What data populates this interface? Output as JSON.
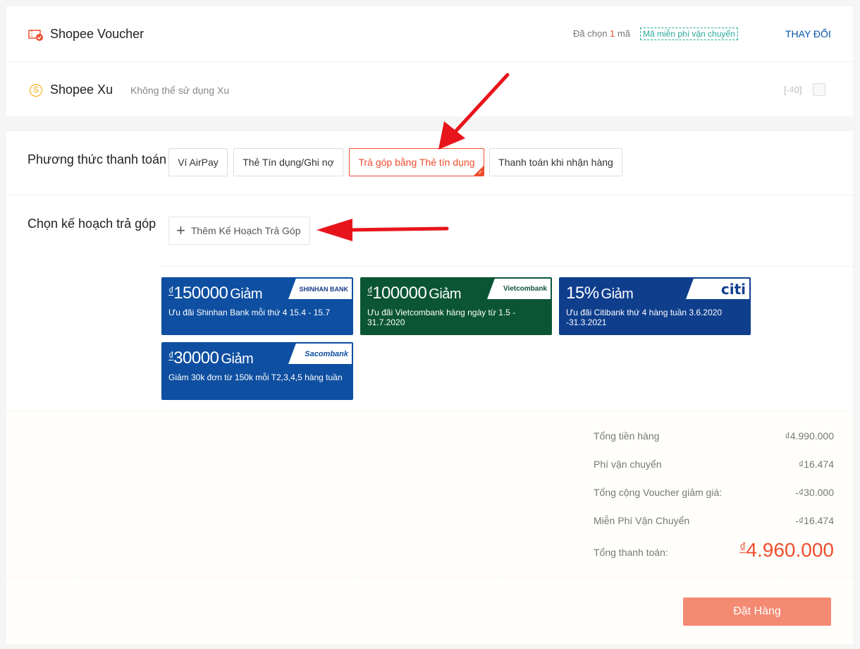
{
  "voucher": {
    "title": "Shopee Voucher",
    "selected_prefix": "Đã chọn",
    "selected_count": "1",
    "selected_suffix": "mã",
    "tag": "Mã miễn phí vận chuyển",
    "change_label": "THAY ĐỔI"
  },
  "xu": {
    "title": "Shopee Xu",
    "note": "Không thể sử dụng Xu",
    "value": "[-₫0]"
  },
  "payment": {
    "label": "Phương thức thanh toán",
    "methods": [
      {
        "label": "Ví AirPay"
      },
      {
        "label": "Thẻ Tín dụng/Ghi nợ"
      },
      {
        "label": "Trả góp bằng Thẻ tín dụng",
        "selected": true
      },
      {
        "label": "Thanh toán khi nhận hàng"
      }
    ]
  },
  "installment": {
    "label": "Chọn kế hoạch trả góp",
    "add_label": "Thêm Kế Hoạch Trả Góp"
  },
  "promos": [
    {
      "currency": "₫",
      "amount": "150000",
      "giam": "Giảm",
      "desc": "Ưu đãi Shinhan Bank mỗi thứ 4 15.4 - 15.7",
      "bank": "SHINHAN BANK",
      "color": "#0e4fa1"
    },
    {
      "currency": "₫",
      "amount": "100000",
      "giam": "Giảm",
      "desc": "Ưu đãi Vietcombank hàng ngày từ 1.5 - 31.7.2020",
      "bank": "Vietcombank",
      "color": "#0b5535"
    },
    {
      "currency": "",
      "amount": "15%",
      "giam": "Giảm",
      "desc": "Ưu đãi Citibank thứ 4 hàng tuần 3.6.2020 -31.3.2021",
      "bank": "citi",
      "color": "#0f3e8d"
    },
    {
      "currency": "₫",
      "amount": "30000",
      "giam": "Giảm",
      "desc": "Giảm 30k đơn từ 150k mỗi T2,3,4,5 hàng tuần",
      "bank": "Sacombank",
      "color": "#0e4fa1"
    }
  ],
  "summary": {
    "rows": [
      {
        "label": "Tổng tiền hàng",
        "value": "₫4.990.000"
      },
      {
        "label": "Phí vận chuyển",
        "value": "₫16.474"
      },
      {
        "label": "Tổng cộng Voucher giảm giá:",
        "value": "-₫30.000"
      },
      {
        "label": "Miễn Phí Vận Chuyển",
        "value": "-₫16.474"
      }
    ],
    "total_label": "Tổng thanh toán:",
    "total_currency": "₫",
    "total_value": "4.960.000"
  },
  "footer": {
    "order_label": "Đặt Hàng"
  },
  "colors": {
    "accent": "#ee4d2d",
    "order_button": "#f48a72",
    "arrow": "#e8141b"
  }
}
